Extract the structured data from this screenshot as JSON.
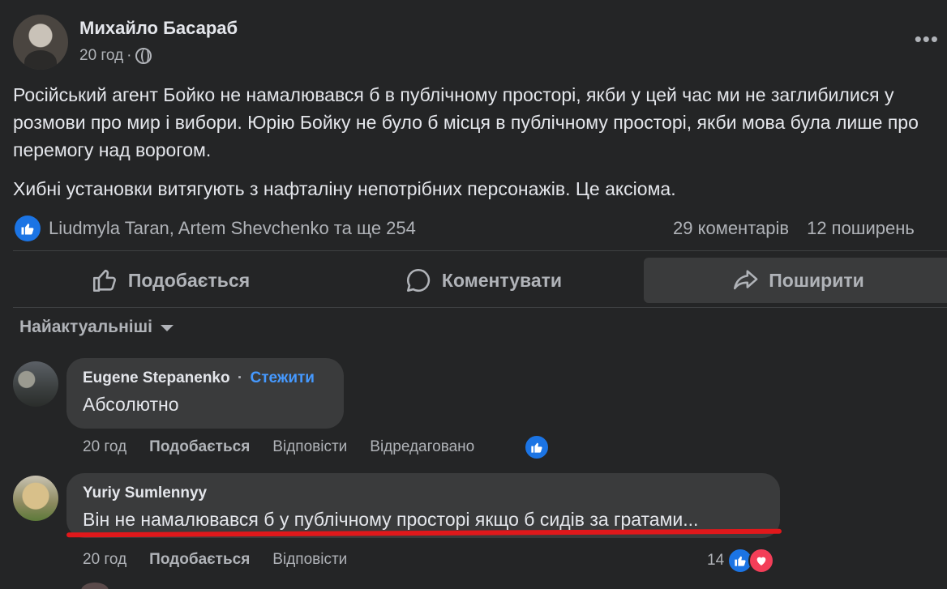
{
  "post": {
    "author": "Михайло Басараб",
    "time": "20 год",
    "separator": "·",
    "more": "•••",
    "paragraphs": [
      "Російський агент Бойко не намалювався б в публічному просторі, якби у цей час ми не заглибилися у розмови про мир і вибори. Юрію Бойку не було б місця в публічному просторі, якби мова була лише про перемогу над ворогом.",
      "Хибні установки витягують з нафталіну непотрібних персонажів. Це аксіома."
    ],
    "reactions_text": "Liudmyla Taran, Artem Shevchenko та ще 254",
    "comments_count": "29 коментарів",
    "shares_count": "12 поширень"
  },
  "actions": {
    "like": "Подобається",
    "comment": "Коментувати",
    "share": "Поширити"
  },
  "sort": {
    "label": "Найактуальніші"
  },
  "comments": [
    {
      "name": "Eugene Stepanenko",
      "dot": "·",
      "follow": "Стежити",
      "text": "Абсолютно",
      "time": "20 год",
      "like": "Подобається",
      "reply": "Відповісти",
      "edited": "Відредаговано"
    },
    {
      "name": "Yuriy Sumlennyy",
      "text": "Він не намалювався б у публічному просторі якщо б сидів за гратами...",
      "time": "20 год",
      "like": "Подобається",
      "reply": "Відповісти",
      "reaction_count": "14"
    }
  ],
  "colors": {
    "background": "#242526",
    "bubble": "#3a3b3c",
    "accent_blue": "#1b74e4",
    "follow_link": "#4599ff",
    "heart": "#f33e58",
    "annotation_red": "#e0181b"
  }
}
